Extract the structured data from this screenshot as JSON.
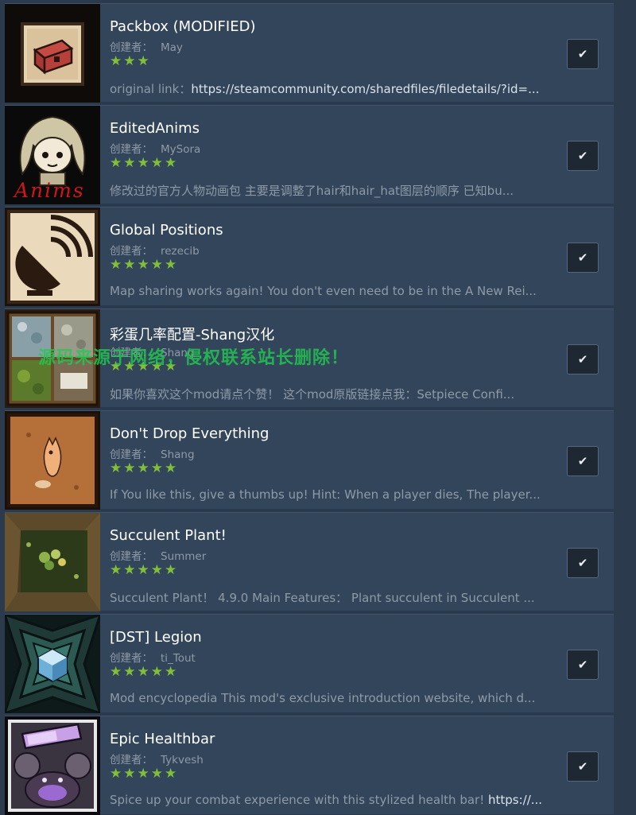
{
  "author_prefix": "创建者：",
  "check_glyph": "✔",
  "colors": {
    "background": "#2b3a4d",
    "row": "#33455b",
    "star": "#7fbf3a",
    "check_bg": "#1e2833"
  },
  "mods": [
    {
      "title": "Packbox (MODIFIED)",
      "author": "May",
      "stars": "★★★",
      "rating": 3,
      "desc_prefix": "original link：",
      "desc_link": "https://steamcommunity.com/sharedfiles/filedetails/?id=...",
      "icon": "red-chest-icon",
      "checked": true
    },
    {
      "title": "EditedAnims",
      "author": "MySora",
      "stars": "★★★★★",
      "rating": 5,
      "desc": "修改过的官方人物动画包 主要是调整了hair和hair_hat图层的顺序 已知bu...",
      "icon": "anims-character-icon",
      "icon_text": "Anims",
      "checked": true
    },
    {
      "title": "Global Positions",
      "author": "rezecib",
      "stars": "★★★★★",
      "rating": 5,
      "desc": "Map sharing works again! You don't even need to be in the A New Rei...",
      "icon": "satellite-dish-icon",
      "checked": true
    },
    {
      "title": "彩蛋几率配置-Shang汉化",
      "author": "Shang",
      "stars": "★★★★★",
      "rating": 5,
      "desc": "如果你喜欢这个mod请点个赞！ 这个mod原版链接点我：Setpiece Confi...",
      "icon": "setpiece-grid-icon",
      "checked": true
    },
    {
      "title": "Don't Drop Everything",
      "author": "Shang",
      "stars": "★★★★★",
      "rating": 5,
      "desc": "If You like this, give a thumbs up! Hint: When a player dies, The player...",
      "icon": "ghost-icon",
      "checked": true
    },
    {
      "title": "Succulent Plant!",
      "author": "Summer",
      "stars": "★★★★★",
      "rating": 5,
      "desc": "Succulent Plant！ 4.9.0 Main Features： Plant succulent in Succulent ...",
      "icon": "succulent-plant-icon",
      "checked": true
    },
    {
      "title": "[DST] Legion",
      "author": "ti_Tout",
      "stars": "★★★★★",
      "rating": 5,
      "desc": "Mod encyclopedia This mod's exclusive introduction website, which d...",
      "icon": "blue-gem-icon",
      "checked": true
    },
    {
      "title": "Epic Healthbar",
      "author": "Tykvesh",
      "stars": "★★★★★",
      "rating": 5,
      "desc_prefix": "Spice up your combat experience with this stylized health bar! ",
      "desc_link": "https://...",
      "icon": "monster-healthbar-icon",
      "checked": true
    }
  ],
  "watermark": "源码来源于网络，侵权联系站长删除！"
}
